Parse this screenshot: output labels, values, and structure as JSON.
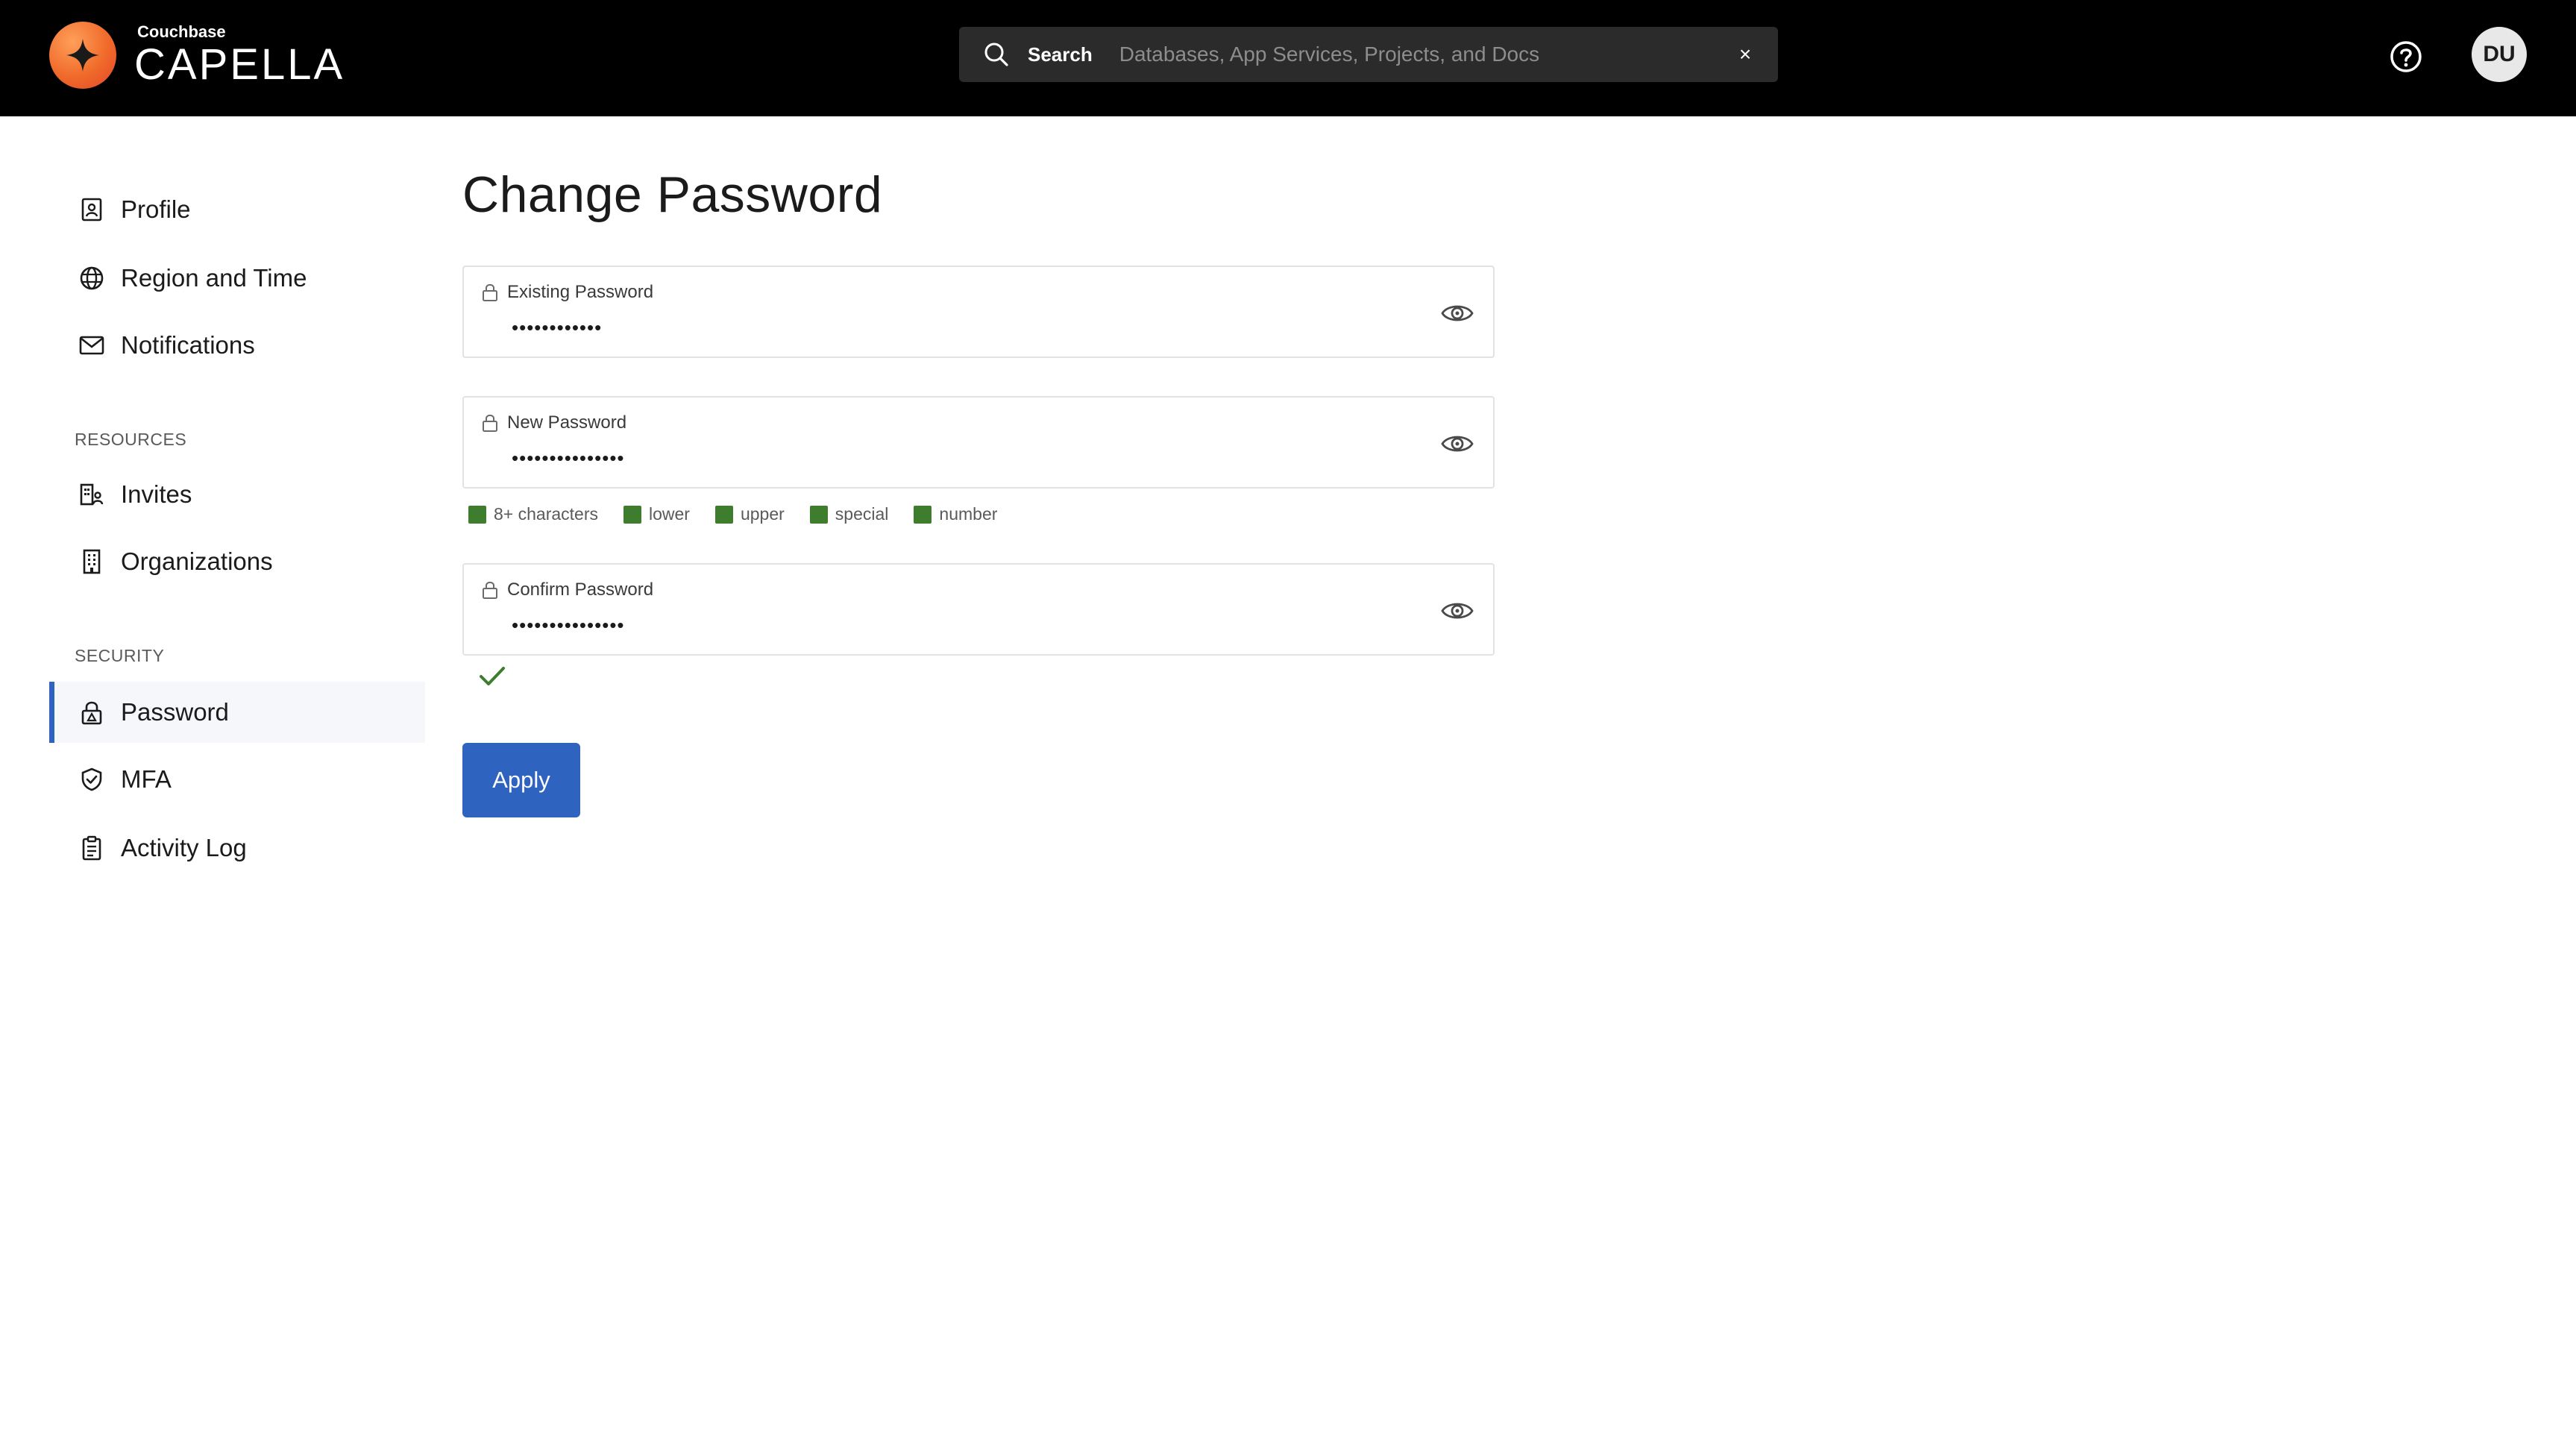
{
  "brand": {
    "small": "Couchbase",
    "name": "CAPELLA"
  },
  "search": {
    "label": "Search",
    "placeholder": "Databases, App Services, Projects, and Docs",
    "clear": "×"
  },
  "user": {
    "initials": "DU"
  },
  "sidebar": {
    "items": [
      {
        "label": "Profile",
        "icon": "profile-icon"
      },
      {
        "label": "Region and Time",
        "icon": "globe-icon"
      },
      {
        "label": "Notifications",
        "icon": "envelope-icon"
      }
    ],
    "resources_label": "RESOURCES",
    "resources": [
      {
        "label": "Invites",
        "icon": "invites-icon"
      },
      {
        "label": "Organizations",
        "icon": "building-icon"
      }
    ],
    "security_label": "SECURITY",
    "security": [
      {
        "label": "Password",
        "icon": "lock-icon",
        "active": true
      },
      {
        "label": "MFA",
        "icon": "shield-icon"
      },
      {
        "label": "Activity Log",
        "icon": "clipboard-icon"
      }
    ]
  },
  "page": {
    "title": "Change Password"
  },
  "form": {
    "existing": {
      "label": "Existing Password",
      "value": "••••••••••••"
    },
    "new": {
      "label": "New Password",
      "value": "•••••••••••••••"
    },
    "confirm": {
      "label": "Confirm Password",
      "value": "•••••••••••••••"
    },
    "rules": [
      "8+ characters",
      "lower",
      "upper",
      "special",
      "number"
    ],
    "apply_label": "Apply"
  },
  "colors": {
    "accent": "#2e63c0",
    "rule_ok": "#3f7d2e",
    "topbar": "#000000"
  }
}
